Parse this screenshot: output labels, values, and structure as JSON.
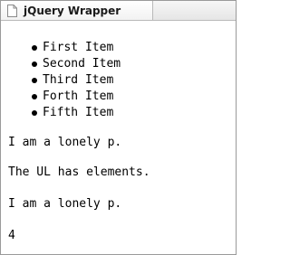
{
  "tab": {
    "title": "jQuery Wrapper",
    "icon": "page-icon"
  },
  "list": {
    "items": [
      "First Item",
      "Second Item",
      "Third Item",
      "Forth Item",
      "Fifth Item"
    ]
  },
  "paragraphs": {
    "p1": "I am a lonely p.",
    "p2": "The UL has elements.",
    "p3": "I am a lonely p.",
    "count": "4"
  }
}
